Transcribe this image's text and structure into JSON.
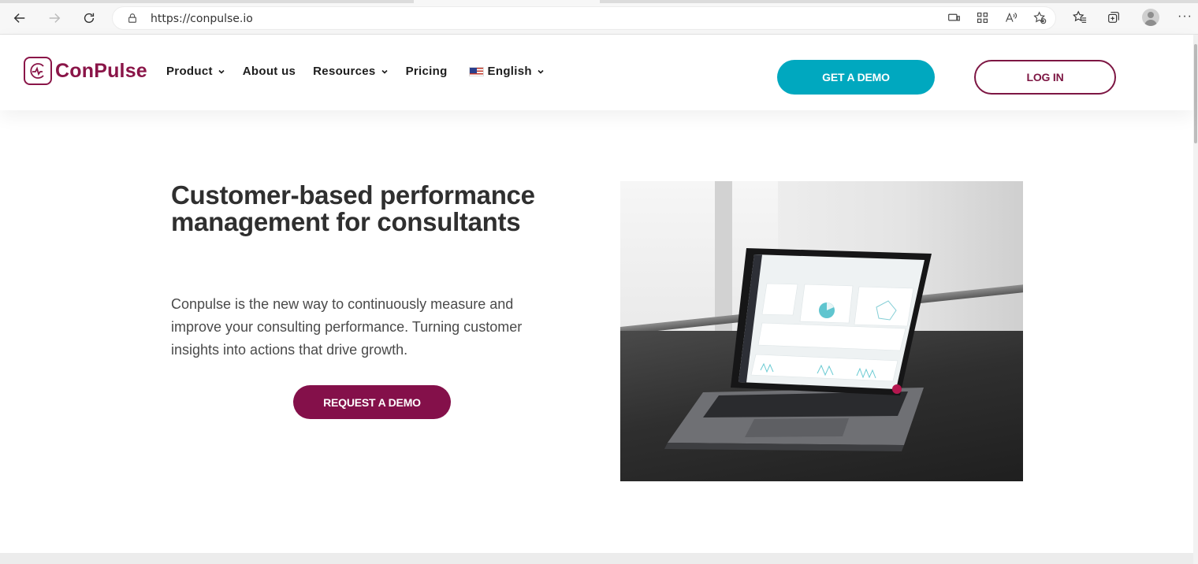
{
  "browser": {
    "url": "https://conpulse.io"
  },
  "site": {
    "logo_text": "ConPulse",
    "nav": [
      {
        "label": "Product",
        "dropdown": true
      },
      {
        "label": "About us",
        "dropdown": false
      },
      {
        "label": "Resources",
        "dropdown": true
      },
      {
        "label": "Pricing",
        "dropdown": false
      },
      {
        "label": "English",
        "dropdown": true
      }
    ],
    "get_demo": "GET A DEMO",
    "log_in": "LOG IN"
  },
  "hero": {
    "title": "Customer-based performance management for consultants",
    "text": "Conpulse is the new way to continuously measure and improve your consulting performance. Turning customer insights into actions that drive growth.",
    "cta": "REQUEST A DEMO"
  },
  "colors": {
    "brand": "#8a1548",
    "accent": "#00a8bf",
    "cta": "#84104a"
  }
}
